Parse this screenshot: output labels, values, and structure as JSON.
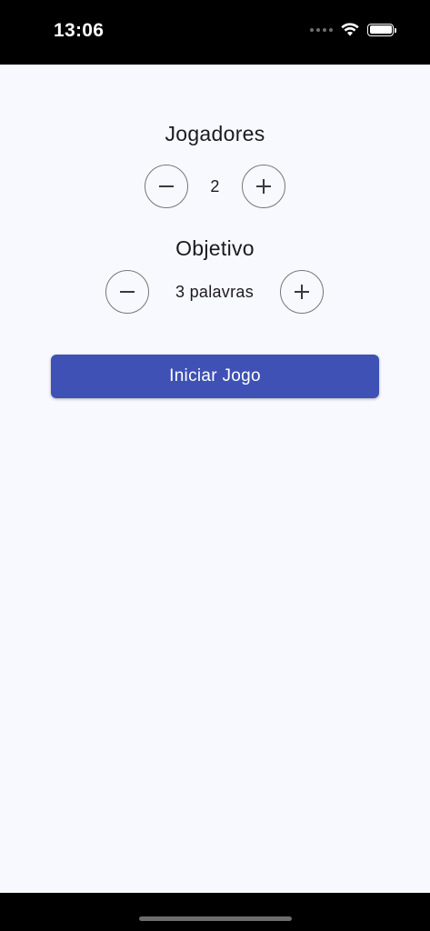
{
  "status_bar": {
    "time": "13:06",
    "icons": [
      "signal-dots-icon",
      "wifi-icon",
      "battery-icon"
    ]
  },
  "players": {
    "title": "Jogadores",
    "value": "2",
    "decrement_icon": "minus-icon",
    "increment_icon": "plus-icon"
  },
  "goal": {
    "title": "Objetivo",
    "value": "3 palavras",
    "decrement_icon": "minus-icon",
    "increment_icon": "plus-icon"
  },
  "start_button": {
    "label": "Iniciar Jogo"
  },
  "colors": {
    "background": "#f8f9fe",
    "primary": "#3f51b5",
    "text": "#1b1b1f",
    "outline": "#77777a"
  }
}
